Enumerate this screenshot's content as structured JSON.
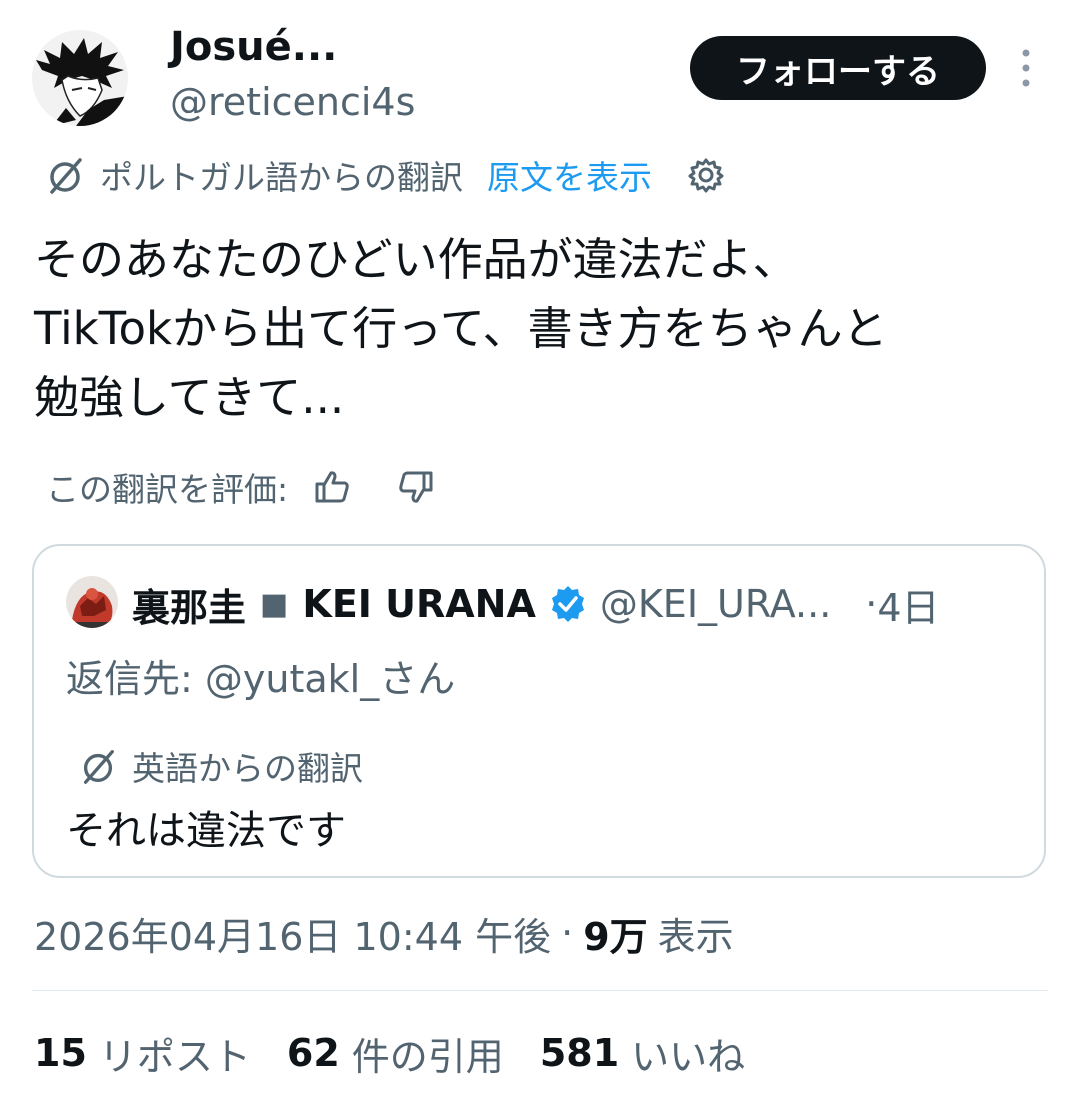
{
  "author": {
    "display_name": "Josué...",
    "handle": "@reticenci4s"
  },
  "follow_button_label": "フォローする",
  "translation": {
    "source_label": "ポルトガル語からの翻訳",
    "show_original_link": "原文を表示"
  },
  "tweet_text_lines": [
    "そのあなたのひどい作品が違法だよ、",
    "TikTokから出て行って、書き方をちゃんと",
    "勉強してきて..."
  ],
  "rate_label": "この翻訳を評価:",
  "quote": {
    "name": "裏那圭",
    "separator": "■",
    "name_en": "KEI URANA",
    "handle": "@KEI_URA...",
    "time": "4日",
    "reply_prefix": "返信先:",
    "reply_to": "@yutakl_さん",
    "translation_label": "英語からの翻訳",
    "text": "それは違法です"
  },
  "meta": {
    "datetime": "2026年04月16日 10:44 午後",
    "views_count": "9万",
    "views_label": "表示"
  },
  "stats": [
    {
      "count": "15",
      "label": "リポスト"
    },
    {
      "count": "62",
      "label": "件の引用"
    },
    {
      "count": "581",
      "label": "いいね"
    }
  ],
  "colors": {
    "text": "#0f1419",
    "secondary": "#536471",
    "link": "#1d9bf0",
    "border": "#cfd9de",
    "follow_bg": "#0f1419"
  },
  "icons": [
    "translate-icon",
    "gear-icon",
    "thumbs-up-icon",
    "thumbs-down-icon",
    "verified-badge-icon",
    "more-options-icon"
  ]
}
